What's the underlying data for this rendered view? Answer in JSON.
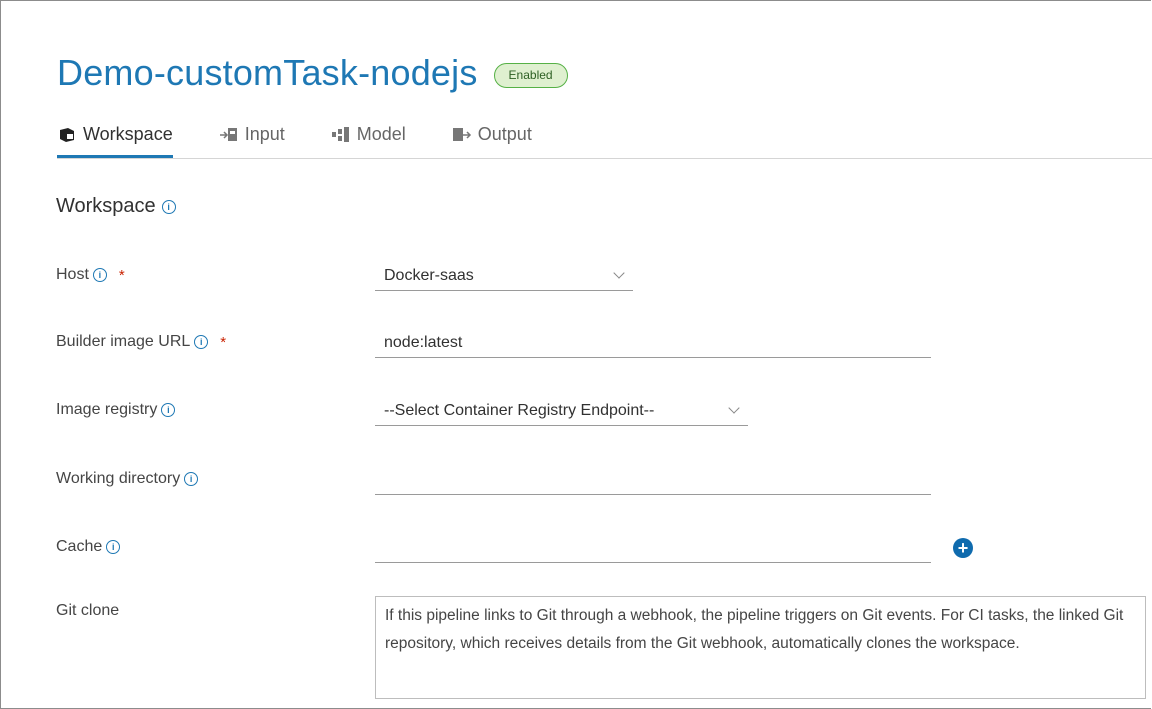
{
  "header": {
    "title": "Demo-customTask-nodejs",
    "status": "Enabled"
  },
  "tabs": [
    {
      "label": "Workspace",
      "icon": "workspace-icon",
      "active": true
    },
    {
      "label": "Input",
      "icon": "input-icon",
      "active": false
    },
    {
      "label": "Model",
      "icon": "model-icon",
      "active": false
    },
    {
      "label": "Output",
      "icon": "output-icon",
      "active": false
    }
  ],
  "section": {
    "title": "Workspace",
    "info": "ⓘ"
  },
  "form": {
    "host": {
      "label": "Host",
      "required": "*",
      "value": "Docker-saas"
    },
    "builder_image": {
      "label": "Builder image URL",
      "required": "*",
      "value": "node:latest"
    },
    "image_registry": {
      "label": "Image registry",
      "value": "--Select Container Registry Endpoint--"
    },
    "working_directory": {
      "label": "Working directory",
      "value": ""
    },
    "cache": {
      "label": "Cache",
      "value": "",
      "add_label": "+"
    },
    "git_clone": {
      "label": "Git clone",
      "text": "If this pipeline links to Git through a webhook, the pipeline triggers on Git events. For CI tasks, the linked Git repository, which receives details from the Git webhook, automatically clones the workspace."
    }
  },
  "colors": {
    "accent": "#1e78b4",
    "badge_border": "#56b146",
    "badge_bg": "#dff0d0",
    "required": "#c92100"
  }
}
